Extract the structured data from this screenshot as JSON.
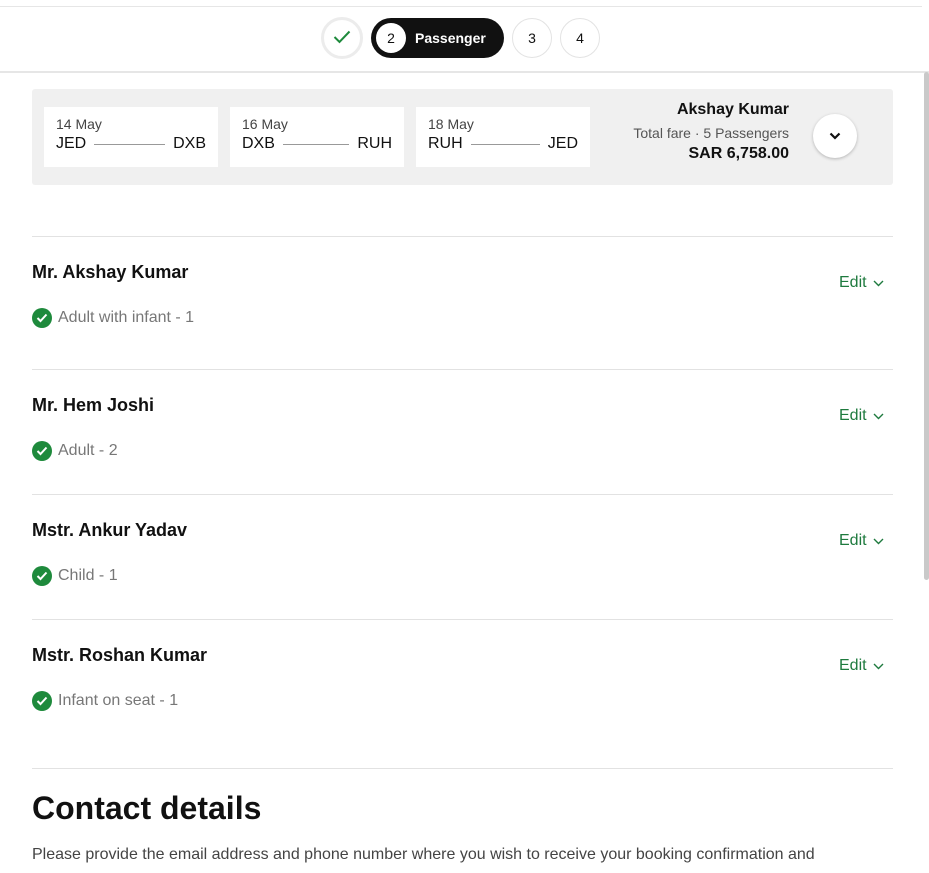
{
  "stepper": {
    "steps": [
      {
        "state": "done",
        "icon": "check-icon"
      },
      {
        "number": "2",
        "label": "Passenger",
        "state": "active"
      },
      {
        "number": "3",
        "state": "pending"
      },
      {
        "number": "4",
        "state": "pending"
      }
    ]
  },
  "itinerary": {
    "legs": [
      {
        "date": "14 May",
        "from": "JED",
        "to": "DXB"
      },
      {
        "date": "16 May",
        "from": "DXB",
        "to": "RUH"
      },
      {
        "date": "18 May",
        "from": "RUH",
        "to": "JED"
      }
    ],
    "lead_passenger": "Akshay Kumar",
    "fare_label": "Total fare · 5 Passengers",
    "fare_amount": "SAR 6,758.00"
  },
  "passengers": [
    {
      "name": "Mr. Akshay Kumar",
      "type": "Adult with infant",
      "index": "1",
      "edit_label": "Edit"
    },
    {
      "name": "Mr. Hem Joshi",
      "type": "Adult",
      "index": "2",
      "edit_label": "Edit"
    },
    {
      "name": "Mstr. Ankur Yadav",
      "type": "Child",
      "index": "1",
      "edit_label": "Edit"
    },
    {
      "name": "Mstr. Roshan Kumar",
      "type": "Infant on seat",
      "index": "1",
      "edit_label": "Edit"
    }
  ],
  "contact": {
    "title": "Contact details",
    "description": "Please provide the email address and phone number where you wish to receive your booking confirmation and"
  },
  "colors": {
    "accent_green": "#1e7a3e",
    "check_green": "#1e8a3c",
    "active_step_bg": "#111111"
  }
}
